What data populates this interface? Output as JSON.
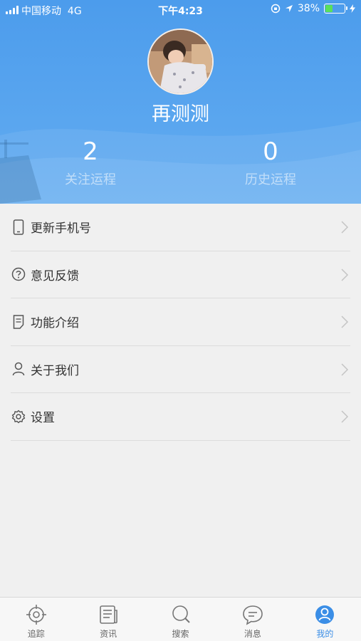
{
  "status": {
    "carrier": "中国移动",
    "network": "4G",
    "time": "下午4:23",
    "battery": "38%",
    "battery_level": 0.38
  },
  "profile": {
    "name": "再测测"
  },
  "stats": [
    {
      "value": "2",
      "label": "关注运程"
    },
    {
      "value": "0",
      "label": "历史运程"
    }
  ],
  "menu": [
    {
      "label": "更新手机号",
      "icon": "phone-icon"
    },
    {
      "label": "意见反馈",
      "icon": "question-icon"
    },
    {
      "label": "功能介绍",
      "icon": "document-icon"
    },
    {
      "label": "关于我们",
      "icon": "person-icon"
    },
    {
      "label": "设置",
      "icon": "gear-icon"
    }
  ],
  "tabs": [
    {
      "label": "追踪",
      "icon": "target-icon"
    },
    {
      "label": "资讯",
      "icon": "news-icon"
    },
    {
      "label": "搜索",
      "icon": "search-icon"
    },
    {
      "label": "消息",
      "icon": "message-icon"
    },
    {
      "label": "我的",
      "icon": "profile-icon",
      "active": true
    }
  ],
  "colors": {
    "header": "#4c9cec",
    "active_tab": "#3b8ee6",
    "background": "#f0f0f0"
  }
}
